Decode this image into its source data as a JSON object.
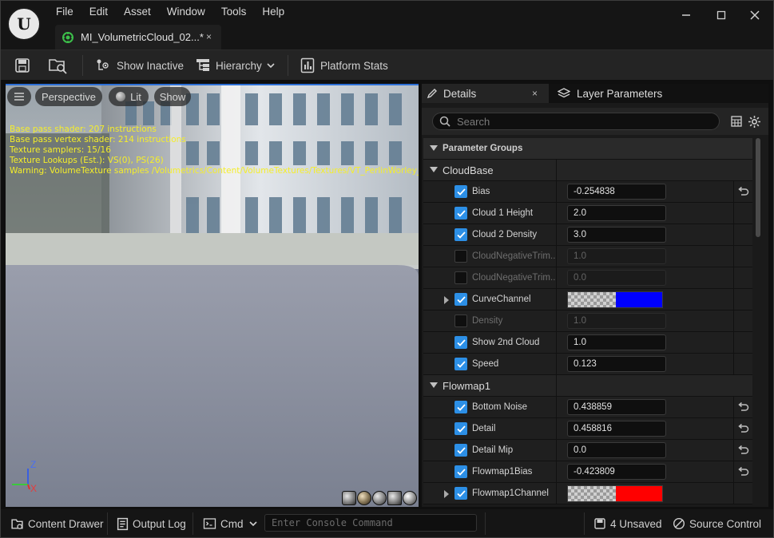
{
  "menu": [
    "File",
    "Edit",
    "Asset",
    "Window",
    "Tools",
    "Help"
  ],
  "asset_tab": {
    "label": "MI_VolumetricCloud_02...*",
    "close": "×"
  },
  "toolbar": {
    "show_inactive": "Show Inactive",
    "hierarchy": "Hierarchy",
    "platform_stats": "Platform Stats"
  },
  "viewport": {
    "perspective": "Perspective",
    "lit": "Lit",
    "show": "Show",
    "stats": [
      "Base pass shader: 207 instructions",
      "Base pass vertex shader: 214 instructions",
      "Texture samplers: 15/16",
      "Texture Lookups (Est.): VS(0), PS(26)",
      "Warning: VolumeTexture samples /Volumetrics/Content/VolumeTextures/Textures/VT_PerlinWorley_Bal"
    ],
    "axis": {
      "z": "Z",
      "x": "X"
    }
  },
  "details": {
    "tab_details": "Details",
    "tab_close": "×",
    "tab_layers": "Layer Parameters",
    "search_placeholder": "Search",
    "param_groups": "Parameter Groups",
    "categories": [
      {
        "name": "CloudBase",
        "props": [
          {
            "name": "Bias",
            "checked": true,
            "value": "-0.254838",
            "reset": true,
            "type": "scalar"
          },
          {
            "name": "Cloud 1 Height",
            "checked": true,
            "value": "2.0",
            "reset": false,
            "type": "scalar"
          },
          {
            "name": "Cloud 2 Density",
            "checked": true,
            "value": "3.0",
            "reset": false,
            "type": "scalar"
          },
          {
            "name": "CloudNegativeTrim...",
            "checked": false,
            "value": "1.0",
            "reset": false,
            "type": "scalar"
          },
          {
            "name": "CloudNegativeTrim...",
            "checked": false,
            "value": "0.0",
            "reset": false,
            "type": "scalar"
          },
          {
            "name": "CurveChannel",
            "checked": true,
            "value": "",
            "reset": false,
            "type": "color",
            "color": "#0000ff",
            "expandable": true
          },
          {
            "name": "Density",
            "checked": false,
            "value": "1.0",
            "reset": false,
            "type": "scalar"
          },
          {
            "name": "Show 2nd Cloud",
            "checked": true,
            "value": "1.0",
            "reset": false,
            "type": "scalar"
          },
          {
            "name": "Speed",
            "checked": true,
            "value": "0.123",
            "reset": false,
            "type": "scalar"
          }
        ]
      },
      {
        "name": "Flowmap1",
        "props": [
          {
            "name": "Bottom Noise",
            "checked": true,
            "value": "0.438859",
            "reset": true,
            "type": "scalar"
          },
          {
            "name": "Detail",
            "checked": true,
            "value": "0.458816",
            "reset": true,
            "type": "scalar"
          },
          {
            "name": "Detail Mip",
            "checked": true,
            "value": "0.0",
            "reset": true,
            "type": "scalar"
          },
          {
            "name": "Flowmap1Bias",
            "checked": true,
            "value": "-0.423809",
            "reset": true,
            "type": "scalar"
          },
          {
            "name": "Flowmap1Channel",
            "checked": true,
            "value": "",
            "reset": false,
            "type": "color",
            "color": "#ff0000",
            "expandable": true
          }
        ]
      }
    ]
  },
  "statusbar": {
    "content_drawer": "Content Drawer",
    "output_log": "Output Log",
    "cmd": "Cmd",
    "console_placeholder": "Enter Console Command",
    "unsaved": "4 Unsaved",
    "source_control": "Source Control"
  },
  "colors": {
    "accent": "#2c6fd6",
    "checkbox": "#2c8fe6",
    "stats_text": "#f5ee2a"
  }
}
